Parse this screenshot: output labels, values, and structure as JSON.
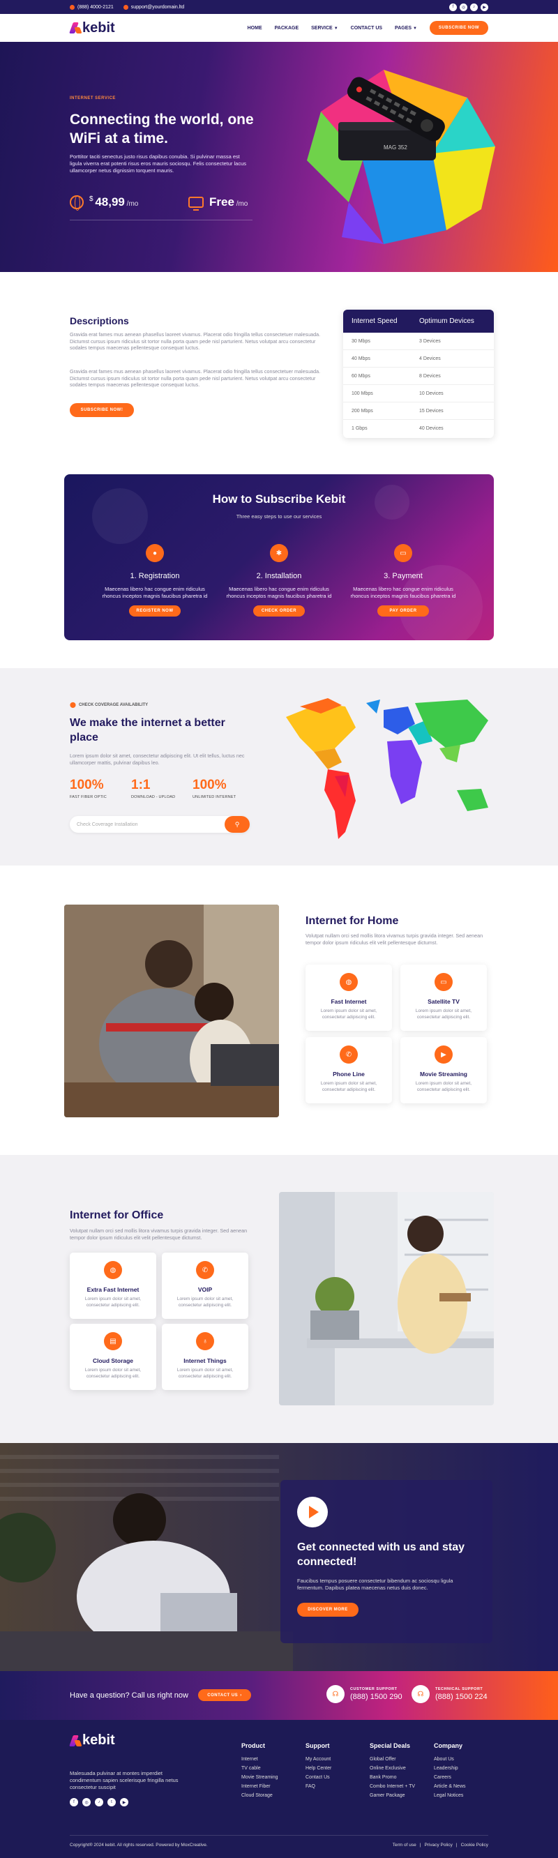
{
  "topbar": {
    "phone": "(888) 4000-2121",
    "email": "support@yourdomain.ltd",
    "socials": [
      "f",
      "◎",
      "♪",
      "▶"
    ]
  },
  "header": {
    "logo": "kebit",
    "nav": [
      "HOME",
      "PACKAGE",
      "SERVICE",
      "CONTACT US",
      "PAGES"
    ],
    "cta": "SUBSCRIBE NOW"
  },
  "hero": {
    "tag": "INTERNET SERVICE",
    "title": "Connecting the world, one WiFi at a time.",
    "desc": "Porttitor taciti senectus justo risus dapibus conubia. Si pulvinar massa est ligula viverra erat potenti risus eros mauris sociosqu. Felis consectetur lacus ullamcorper netus dignissim torquent mauris.",
    "price_currency": "$",
    "price": "48,99",
    "price_unit": "/mo",
    "free": "Free",
    "free_unit": "/mo",
    "device_label": "MAG 352"
  },
  "descriptions": {
    "title": "Descriptions",
    "p1": "Gravida erat fames mus aenean phasellus laoreet vivamus. Placerat odio fringilla tellus consectetuer malesuada. Dictumst cursus ipsum ridiculus sit tortor nulla porta quam pede nisl parturient. Netus volutpat arcu consectetur sodales tempus maecenas pellentesque consequat luctus.",
    "p2": "Gravida erat fames mus aenean phasellus laoreet vivamus. Placerat odio fringilla tellus consectetuer malesuada. Dictumst cursus ipsum ridiculus sit tortor nulla porta quam pede nisl parturient. Netus volutpat arcu consectetur sodales tempus maecenas pellentesque consequat luctus.",
    "button": "SUBSCRIBE NOW!",
    "table": {
      "headers": [
        "Internet Speed",
        "Optimum Devices"
      ],
      "rows": [
        [
          "30 Mbps",
          "3 Devices"
        ],
        [
          "40 Mbps",
          "4 Devices"
        ],
        [
          "60 Mbps",
          "8 Devices"
        ],
        [
          "100 Mbps",
          "10 Devices"
        ],
        [
          "200 Mbps",
          "15 Devices"
        ],
        [
          "1 Gbps",
          "40 Devices"
        ]
      ]
    }
  },
  "subscribe": {
    "title": "How to Subscribe Kebit",
    "subtitle": "Three easy steps to use our services",
    "steps": [
      {
        "title": "1. Registration",
        "desc": "Maecenas libero hac congue enim ridiculus rhoncus inceptos magnis faucibus pharetra id",
        "button": "REGISTER NOW",
        "icon": "user-icon"
      },
      {
        "title": "2. Installation",
        "desc": "Maecenas libero hac congue enim ridiculus rhoncus inceptos magnis faucibus pharetra id",
        "button": "CHECK ORDER",
        "icon": "gear-icon"
      },
      {
        "title": "3. Payment",
        "desc": "Maecenas libero hac congue enim ridiculus rhoncus inceptos magnis faucibus pharetra id",
        "button": "PAY ORDER",
        "icon": "card-icon"
      }
    ]
  },
  "coverage": {
    "tag": "CHECK COVERAGE AVAILABILITY",
    "title": "We make the internet a better place",
    "desc": "Lorem ipsum dolor sit amet, consectetur adipiscing elit. Ut elit tellus, luctus nec ullamcorper mattis, pulvinar dapibus leo.",
    "stats": [
      {
        "value": "100%",
        "label": "FAST FIBER OPTIC"
      },
      {
        "value": "1:1",
        "label": "DOWNLOAD - UPLOAD"
      },
      {
        "value": "100%",
        "label": "UNLIMITED INTERNET"
      }
    ],
    "placeholder": "Check Coverage Installation"
  },
  "home": {
    "title": "Internet for Home",
    "desc": "Volutpat nullam orci sed mollis litora vivamus turpis gravida integer. Sed aenean tempor dolor ipsum ridiculus elit velit pellentesque dictumst.",
    "features": [
      {
        "title": "Fast Internet",
        "desc": "Lorem ipsum dolor sit amet, consectetur adipiscing elit."
      },
      {
        "title": "Satellite TV",
        "desc": "Lorem ipsum dolor sit amet, consectetur adipiscing elit."
      },
      {
        "title": "Phone Line",
        "desc": "Lorem ipsum dolor sit amet, consectetur adipiscing elit."
      },
      {
        "title": "Movie Streaming",
        "desc": "Lorem ipsum dolor sit amet, consectetur adipiscing elit."
      }
    ]
  },
  "office": {
    "title": "Internet for Office",
    "desc": "Volutpat nullam orci sed mollis litora vivamus turpis gravida integer. Sed aenean tempor dolor ipsum ridiculus elit velit pellentesque dictumst.",
    "features": [
      {
        "title": "Extra Fast Internet",
        "desc": "Lorem ipsum dolor sit amet, consectetur adipiscing elit."
      },
      {
        "title": "VOIP",
        "desc": "Lorem ipsum dolor sit amet, consectetur adipiscing elit."
      },
      {
        "title": "Cloud Storage",
        "desc": "Lorem ipsum dolor sit amet, consectetur adipiscing elit."
      },
      {
        "title": "Internet Things",
        "desc": "Lorem ipsum dolor sit amet, consectetur adipiscing elit."
      }
    ]
  },
  "connect": {
    "title": "Get connected with us and stay connected!",
    "desc": "Faucibus tempus posuere consectetur bibendum ac sociosqu ligula fermentum. Dapibus platea maecenas netus duis donec.",
    "button": "DISCOVER MORE"
  },
  "band": {
    "question": "Have a question? Call us right now",
    "button": "CONTACT US",
    "customer_label": "CUSTOMER SUPPORT",
    "customer_phone": "(888) 1500 290",
    "technical_label": "TECHNICAL SUPPORT",
    "technical_phone": "(888) 1500 224"
  },
  "footer": {
    "logo": "kebit",
    "desc": "Malesuada pulvinar at montes imperdiet condimentum sapien scelerisque fringilla netus consectetur suscipit",
    "socials": [
      "f",
      "◎",
      "♪",
      "t",
      "▶"
    ],
    "columns": [
      {
        "title": "Product",
        "items": [
          "Internet",
          "TV cable",
          "Movie Streaming",
          "Internet Fiber",
          "Cloud Storage"
        ]
      },
      {
        "title": "Support",
        "items": [
          "My Account",
          "Help Center",
          "Contact Us",
          "FAQ"
        ]
      },
      {
        "title": "Special Deals",
        "items": [
          "Global Offer",
          "Online Exclusive",
          "Bank Promo",
          "Combo Internet + TV",
          "Gamer Package"
        ]
      },
      {
        "title": "Company",
        "items": [
          "About Us",
          "Leadership",
          "Careers",
          "Article & News",
          "Legal Notices"
        ]
      }
    ],
    "copyright": "Copyright® 2024 kebit. All rights reserved. Powered by MoxCreative.",
    "legal": [
      "Term of use",
      "|",
      "Privacy Policy",
      "|",
      "Cookie Policy"
    ]
  },
  "colors": {
    "navy": "#221a5e",
    "orange": "#ff6a1a",
    "magenta": "#b8237f"
  }
}
